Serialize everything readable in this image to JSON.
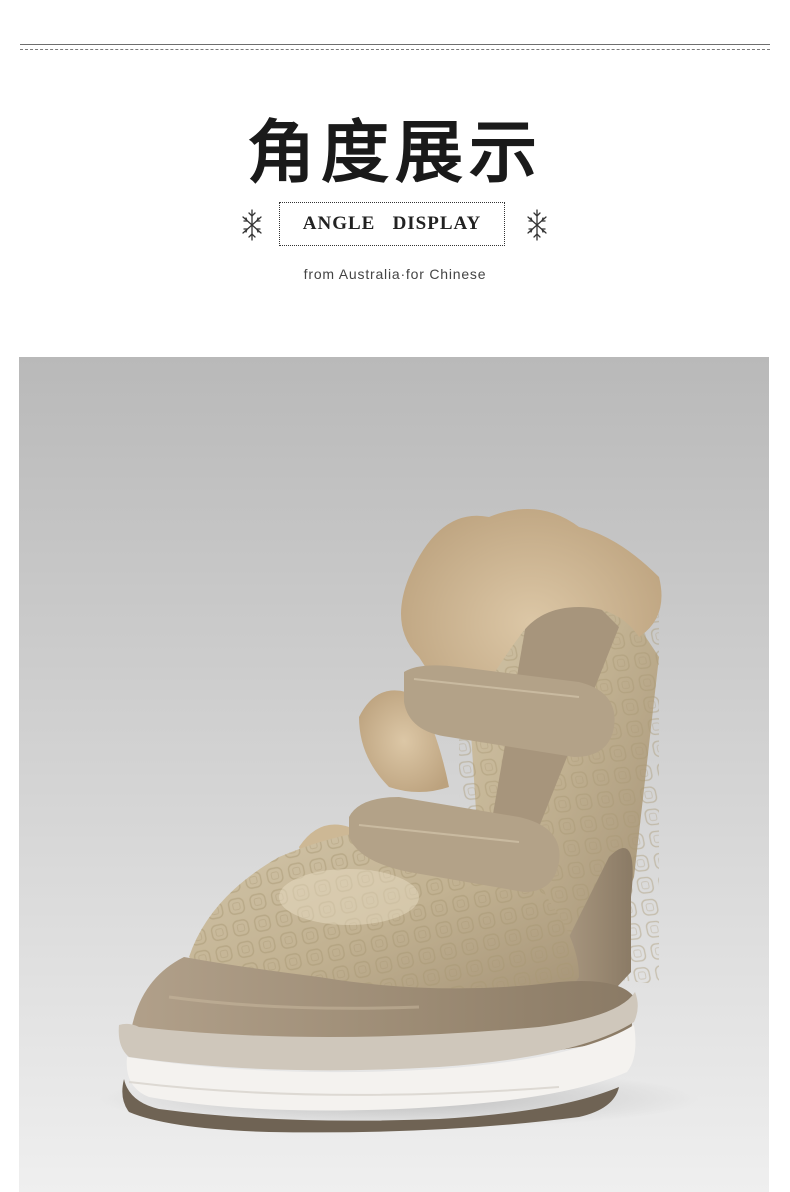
{
  "header": {
    "title_cn": "角度展示",
    "badge_text": "ANGLE   DISPLAY",
    "subtitle": "from Australia·for Chinese",
    "decor_icon_left": "snowflake-icon",
    "decor_icon_right": "snowflake-icon"
  },
  "photo": {
    "subject": "product-photo-boot",
    "colors": {
      "background_top": "#b9b9b9",
      "background_bottom": "#efefef",
      "upper": "#c3b394",
      "suede": "#9b8a73",
      "fur": "#cbb392",
      "sole": "#f4f2ef"
    }
  }
}
